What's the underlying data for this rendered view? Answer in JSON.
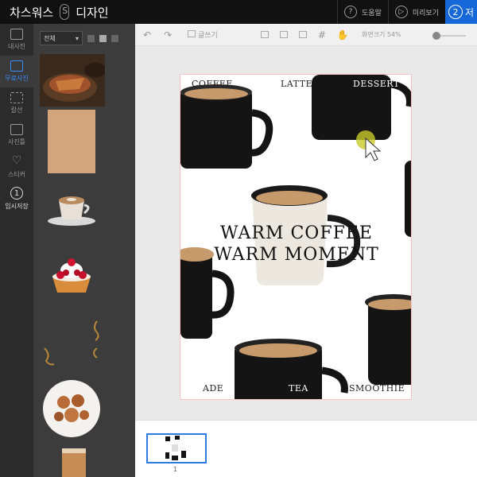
{
  "app": {
    "brand_left": "차스워스",
    "brand_right": "디자인"
  },
  "topbar": {
    "help": {
      "num": "?",
      "label": "도움말"
    },
    "preview": {
      "num": "▷",
      "label": "미리보기"
    },
    "save": {
      "num": "2",
      "label": "저"
    }
  },
  "rail": {
    "items": [
      {
        "label": "내사진",
        "icon": "photo-icon",
        "active": false
      },
      {
        "label": "무료사진",
        "icon": "free-photo-icon",
        "active": true
      },
      {
        "label": "칼선",
        "icon": "cutline-icon",
        "active": false
      },
      {
        "label": "사진틀",
        "icon": "frame-icon",
        "active": false
      },
      {
        "label": "스티커",
        "icon": "heart-icon",
        "active": false
      },
      {
        "label": "임시저장",
        "icon": "temp-save-icon",
        "active": false,
        "num": "1"
      }
    ]
  },
  "panel": {
    "filter_value": "전체"
  },
  "toolbar": {
    "text_tool": "글쓰기",
    "zoom_label": "화면크기 54%"
  },
  "design": {
    "top_labels": [
      "COFFEE",
      "LATTE",
      "DESSERT"
    ],
    "headline_1": "WARM COFFEE",
    "headline_2": "WARM MOMENT",
    "bottom_labels": [
      "ADE",
      "TEA",
      "SMOOTHIE"
    ]
  },
  "filmstrip": {
    "page_number": "1"
  },
  "colors": {
    "accent": "#1668d8",
    "active_rail": "#3b8cff",
    "mug_black": "#141414",
    "mug_cream": "#ece8df",
    "coffee": "#c79a6c"
  }
}
